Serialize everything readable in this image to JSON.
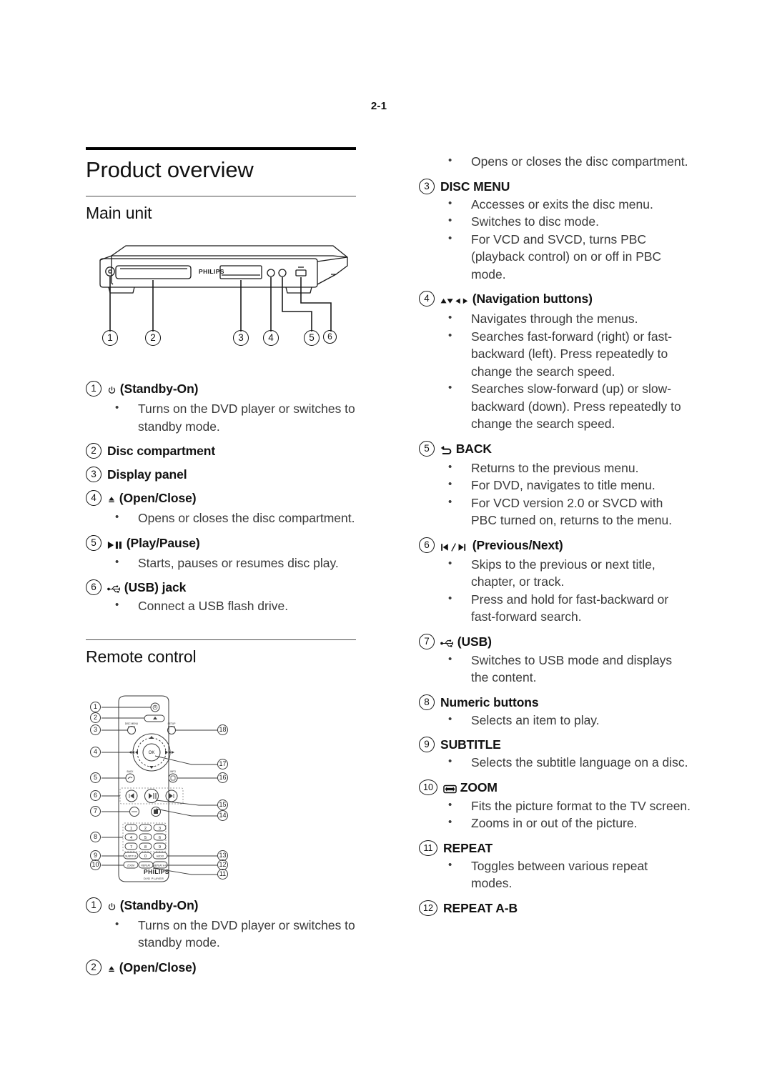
{
  "page": {
    "number": "2-1"
  },
  "headings": {
    "title": "Product overview",
    "main_unit": "Main unit",
    "remote_control": "Remote control"
  },
  "main_unit_entries": [
    {
      "num": "1",
      "icon": "power-icon",
      "label": "(Standby-On)",
      "bullets": [
        "Turns on the DVD player or switches to standby mode."
      ]
    },
    {
      "num": "2",
      "icon": "",
      "label": "Disc compartment",
      "bullets": []
    },
    {
      "num": "3",
      "icon": "",
      "label": "Display panel",
      "bullets": []
    },
    {
      "num": "4",
      "icon": "eject-icon",
      "label": "(Open/Close)",
      "bullets": [
        "Opens or closes the disc compartment."
      ]
    },
    {
      "num": "5",
      "icon": "play-pause-icon",
      "label": "(Play/Pause)",
      "bullets": [
        "Starts, pauses or resumes disc play."
      ]
    },
    {
      "num": "6",
      "icon": "usb-icon",
      "label": "(USB) jack",
      "bullets": [
        "Connect a USB flash drive."
      ]
    }
  ],
  "remote_entries_left": [
    {
      "num": "1",
      "icon": "power-icon",
      "label": "(Standby-On)",
      "bullets": [
        "Turns on the DVD player or switches to standby mode."
      ]
    },
    {
      "num": "2",
      "icon": "eject-icon",
      "label": "(Open/Close)",
      "bullets": []
    }
  ],
  "remote_entries_right": {
    "continuation_bullets": [
      "Opens or closes the disc compartment."
    ],
    "entries": [
      {
        "num": "3",
        "icon": "",
        "label": "DISC MENU",
        "bullets": [
          "Accesses or exits the disc menu.",
          "Switches to disc mode.",
          "For VCD and SVCD, turns PBC (playback control) on or off in PBC mode."
        ]
      },
      {
        "num": "4",
        "icon": "navigation-icon",
        "label": "(Navigation buttons)",
        "bullets": [
          "Navigates through the menus.",
          "Searches fast-forward (right) or fast-backward (left). Press repeatedly to change the search speed.",
          "Searches slow-forward (up) or slow-backward (down). Press repeatedly to change the search speed."
        ]
      },
      {
        "num": "5",
        "icon": "back-icon",
        "label": "BACK",
        "bullets": [
          "Returns to the previous menu.",
          "For DVD, navigates to title menu.",
          "For VCD version 2.0 or SVCD with PBC turned on, returns to the menu."
        ]
      },
      {
        "num": "6",
        "icon": "previous-next-icon",
        "label": "(Previous/Next)",
        "bullets": [
          "Skips to the previous or next title, chapter, or track.",
          "Press and hold for fast-backward or fast-forward search."
        ]
      },
      {
        "num": "7",
        "icon": "usb-icon",
        "label": "(USB)",
        "bullets": [
          "Switches to USB mode and displays the content."
        ]
      },
      {
        "num": "8",
        "icon": "",
        "label": "Numeric buttons",
        "bullets": [
          "Selects an item to play."
        ]
      },
      {
        "num": "9",
        "icon": "",
        "label": "SUBTITLE",
        "bullets": [
          "Selects the subtitle language on a disc."
        ]
      },
      {
        "num": "10",
        "icon": "zoom-icon",
        "label": "ZOOM",
        "bullets": [
          "Fits the picture format to the TV screen.",
          "Zooms in or out of the picture."
        ]
      },
      {
        "num": "11",
        "icon": "",
        "label": "REPEAT",
        "bullets": [
          "Toggles between various repeat modes."
        ]
      },
      {
        "num": "12",
        "icon": "",
        "label": "REPEAT A-B",
        "bullets": []
      }
    ]
  },
  "figures": {
    "main_unit": {
      "brand": "PHILIPS",
      "callouts": [
        "1",
        "2",
        "3",
        "4",
        "5",
        "6"
      ]
    },
    "remote": {
      "brand": "PHILIPS",
      "model_text": "DVD PLAYER",
      "ok_label": "OK",
      "numeric_keys": [
        "1",
        "2",
        "3",
        "4",
        "5",
        "6",
        "7",
        "8",
        "9",
        "0"
      ],
      "button_labels": {
        "disc_menu": "DISC MENU",
        "setup": "SETUP",
        "back": "BACK",
        "info": "INFO",
        "subtitle": "SUBTITLE",
        "audio": "AUDIO",
        "zoom": "ZOOM",
        "repeat": "REPEAT",
        "repeat_ab": "REPEAT A-B"
      },
      "callouts_left": [
        "1",
        "2",
        "3",
        "4",
        "5",
        "6",
        "7",
        "8",
        "9",
        "10"
      ],
      "callouts_right": [
        "18",
        "17",
        "16",
        "15",
        "14",
        "13",
        "12",
        "11"
      ]
    }
  },
  "colors": {
    "text": "#1a1a1a",
    "body_text": "#3a3a3a",
    "rule": "#000000"
  }
}
